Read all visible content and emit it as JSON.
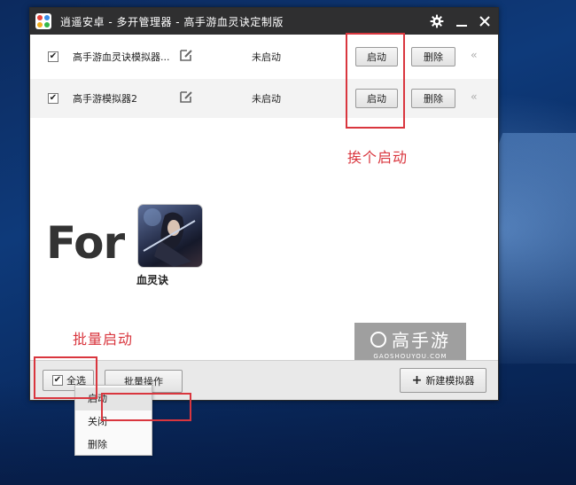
{
  "window": {
    "title": "逍遥安卓 - 多开管理器 - 高手游血灵诀定制版",
    "settings_icon": "gear-icon",
    "minimize_icon": "minimize-icon",
    "close_icon": "close-icon"
  },
  "emulators": [
    {
      "checked": "✔",
      "name": "高手游血灵诀模拟器...",
      "status": "未启动",
      "start_label": "启动",
      "delete_label": "删除"
    },
    {
      "checked": "✔",
      "name": "高手游模拟器2",
      "status": "未启动",
      "start_label": "启动",
      "delete_label": "删除"
    }
  ],
  "annotations": {
    "individual_start": "挨个启动",
    "batch_start": "批量启动",
    "color": "#d9363e"
  },
  "promo": {
    "for_text": "For",
    "game_name": "血灵诀",
    "watermark_main": "高手游",
    "watermark_sub": "GAOSHOUYOU.COM"
  },
  "bottombar": {
    "select_all_check": "✔",
    "select_all_label": "全选",
    "batch_label": "批量操作",
    "new_label": "新建模拟器",
    "new_icon": "plus-icon"
  },
  "batch_menu": {
    "items": [
      "启动",
      "关闭",
      "删除"
    ],
    "highlighted": "启动"
  }
}
